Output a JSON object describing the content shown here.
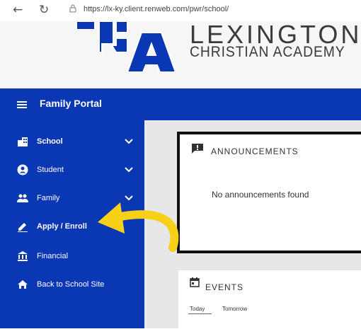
{
  "browser": {
    "url": "https://lx-ky.client.renweb.com/pwr/school/"
  },
  "header": {
    "logo_text": "LCA",
    "name_line1": "LEXINGTON",
    "name_line2": "CHRISTIAN ACADEMY"
  },
  "topbar": {
    "title": "Family Portal"
  },
  "sidebar": {
    "items": [
      {
        "label": "School",
        "icon": "building-icon",
        "expandable": true,
        "active": true
      },
      {
        "label": "Student",
        "icon": "account-icon",
        "expandable": true
      },
      {
        "label": "Family",
        "icon": "people-icon",
        "expandable": true
      },
      {
        "label": "Apply / Enroll",
        "icon": "pencil-icon",
        "expandable": false,
        "bold": true
      },
      {
        "label": "Financial",
        "icon": "bank-icon",
        "expandable": false
      },
      {
        "label": "Back to School Site",
        "icon": "home-icon",
        "expandable": false
      }
    ]
  },
  "announcements": {
    "title": "ANNOUNCEMENTS",
    "empty_message": "No announcements found"
  },
  "events": {
    "title": "EVENTS",
    "tabs": [
      "Today",
      "Tomorrow"
    ]
  },
  "colors": {
    "brand_blue": "#0a37b4",
    "annotation_arrow": "#f7d117"
  }
}
